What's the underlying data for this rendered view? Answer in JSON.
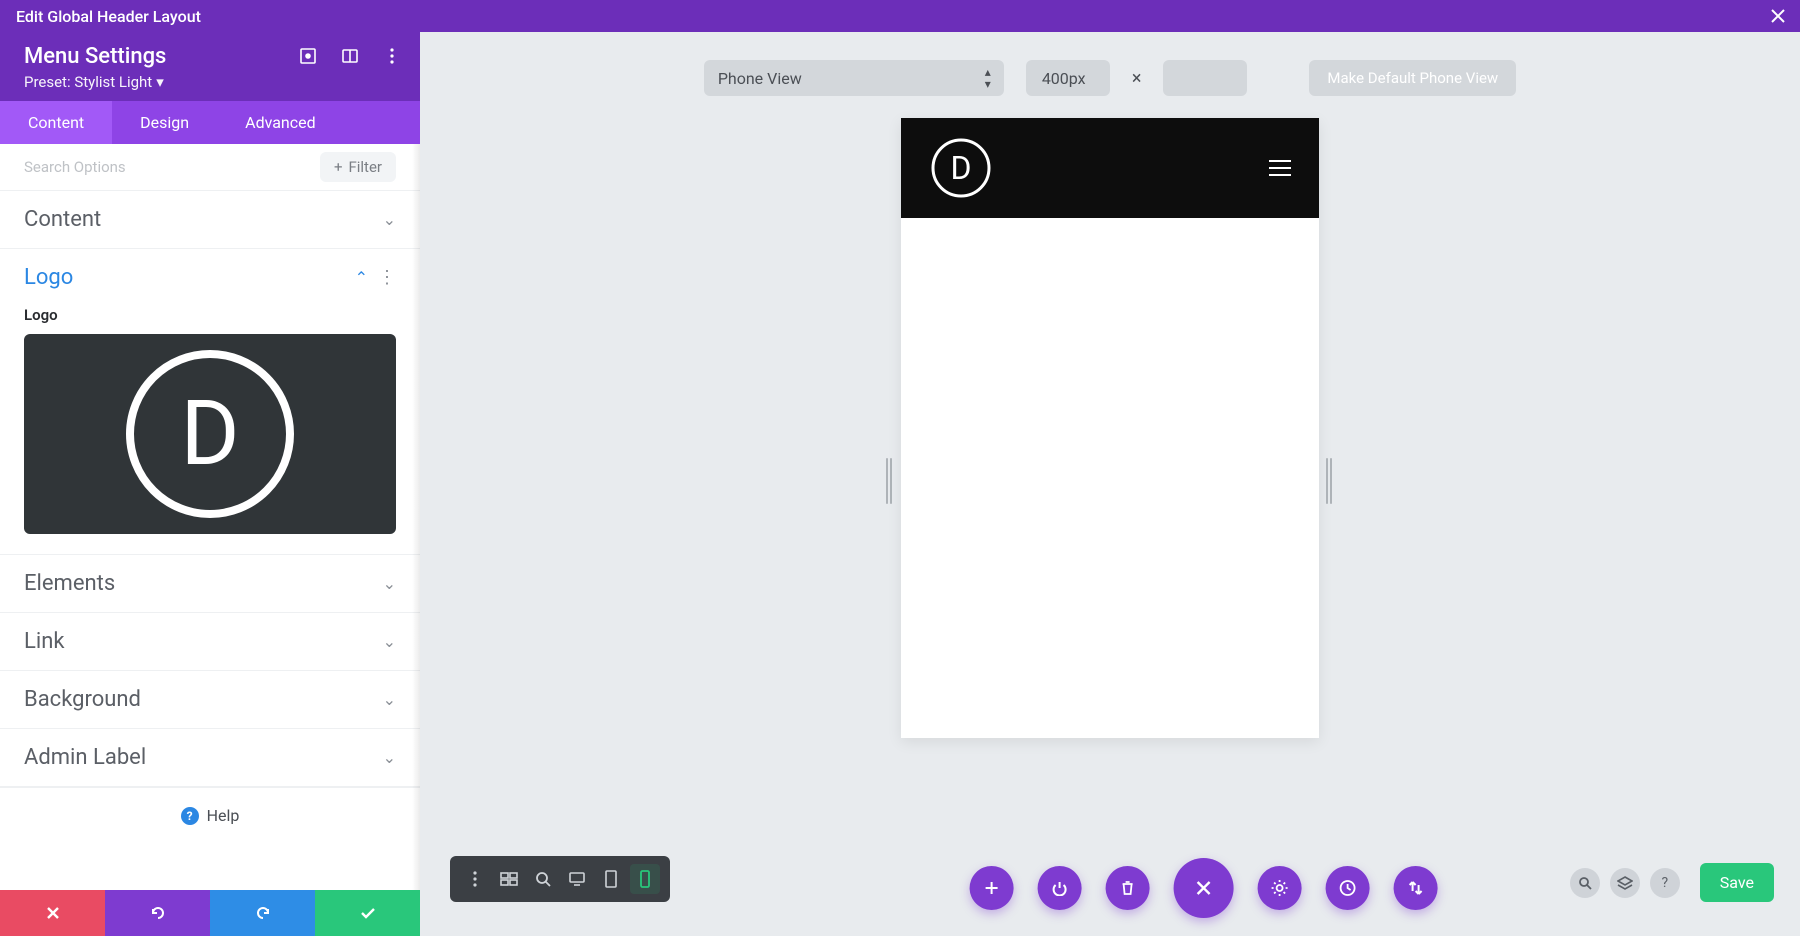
{
  "topbar": {
    "title": "Edit Global Header Layout"
  },
  "sidebar": {
    "title": "Menu Settings",
    "preset_label": "Preset: Stylist Light",
    "tabs": [
      "Content",
      "Design",
      "Advanced"
    ],
    "active_tab": 0,
    "search_placeholder": "Search Options",
    "filter_label": "Filter",
    "sections": {
      "content": "Content",
      "logo": "Logo",
      "logo_field_label": "Logo",
      "elements": "Elements",
      "link": "Link",
      "background": "Background",
      "admin_label": "Admin Label"
    },
    "help_label": "Help"
  },
  "canvas": {
    "view_select": "Phone View",
    "width_value": "400px",
    "default_button": "Make Default Phone View"
  },
  "bottom_right": {
    "save_label": "Save"
  },
  "colors": {
    "purple": "#6c2eb9",
    "purple_light": "#8e44e6",
    "green": "#29c77b",
    "red": "#e94b63",
    "blue": "#2e8de6"
  }
}
